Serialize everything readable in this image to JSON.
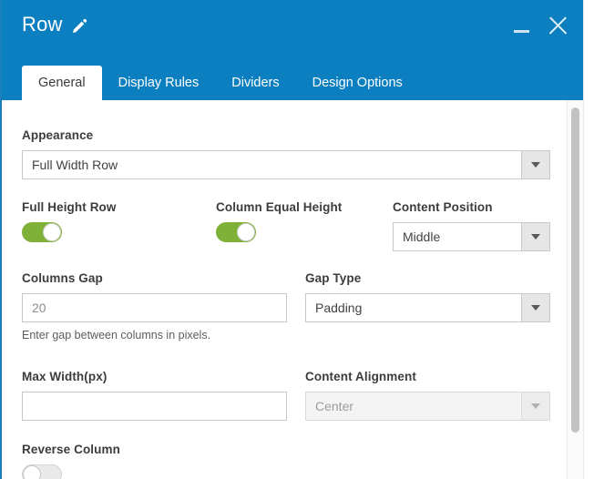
{
  "window": {
    "title": "Row",
    "edit_icon": "pencil-icon",
    "minimize_label": "_",
    "close_label": "X",
    "accent_color": "#0c7fc0"
  },
  "tabs": [
    {
      "label": "General",
      "active": true
    },
    {
      "label": "Display Rules",
      "active": false
    },
    {
      "label": "Dividers",
      "active": false
    },
    {
      "label": "Design Options",
      "active": false
    }
  ],
  "form": {
    "appearance": {
      "label": "Appearance",
      "value": "Full Width Row"
    },
    "full_height_row": {
      "label": "Full Height Row",
      "state": "on"
    },
    "column_equal_height": {
      "label": "Column Equal Height",
      "state": "on"
    },
    "content_position": {
      "label": "Content Position",
      "value": "Middle"
    },
    "columns_gap": {
      "label": "Columns Gap",
      "value": "",
      "placeholder": "20",
      "help": "Enter gap between columns in pixels."
    },
    "gap_type": {
      "label": "Gap Type",
      "value": "Padding"
    },
    "max_width": {
      "label": "Max Width(px)",
      "value": "",
      "placeholder": ""
    },
    "content_alignment": {
      "label": "Content Alignment",
      "value": "Center",
      "disabled": true
    },
    "reverse_column": {
      "label": "Reverse Column",
      "state": "off"
    }
  },
  "colors": {
    "toggle_on": "#7fb139",
    "toggle_off": "#e9e9e9",
    "header_blue": "#0c7fc0"
  }
}
